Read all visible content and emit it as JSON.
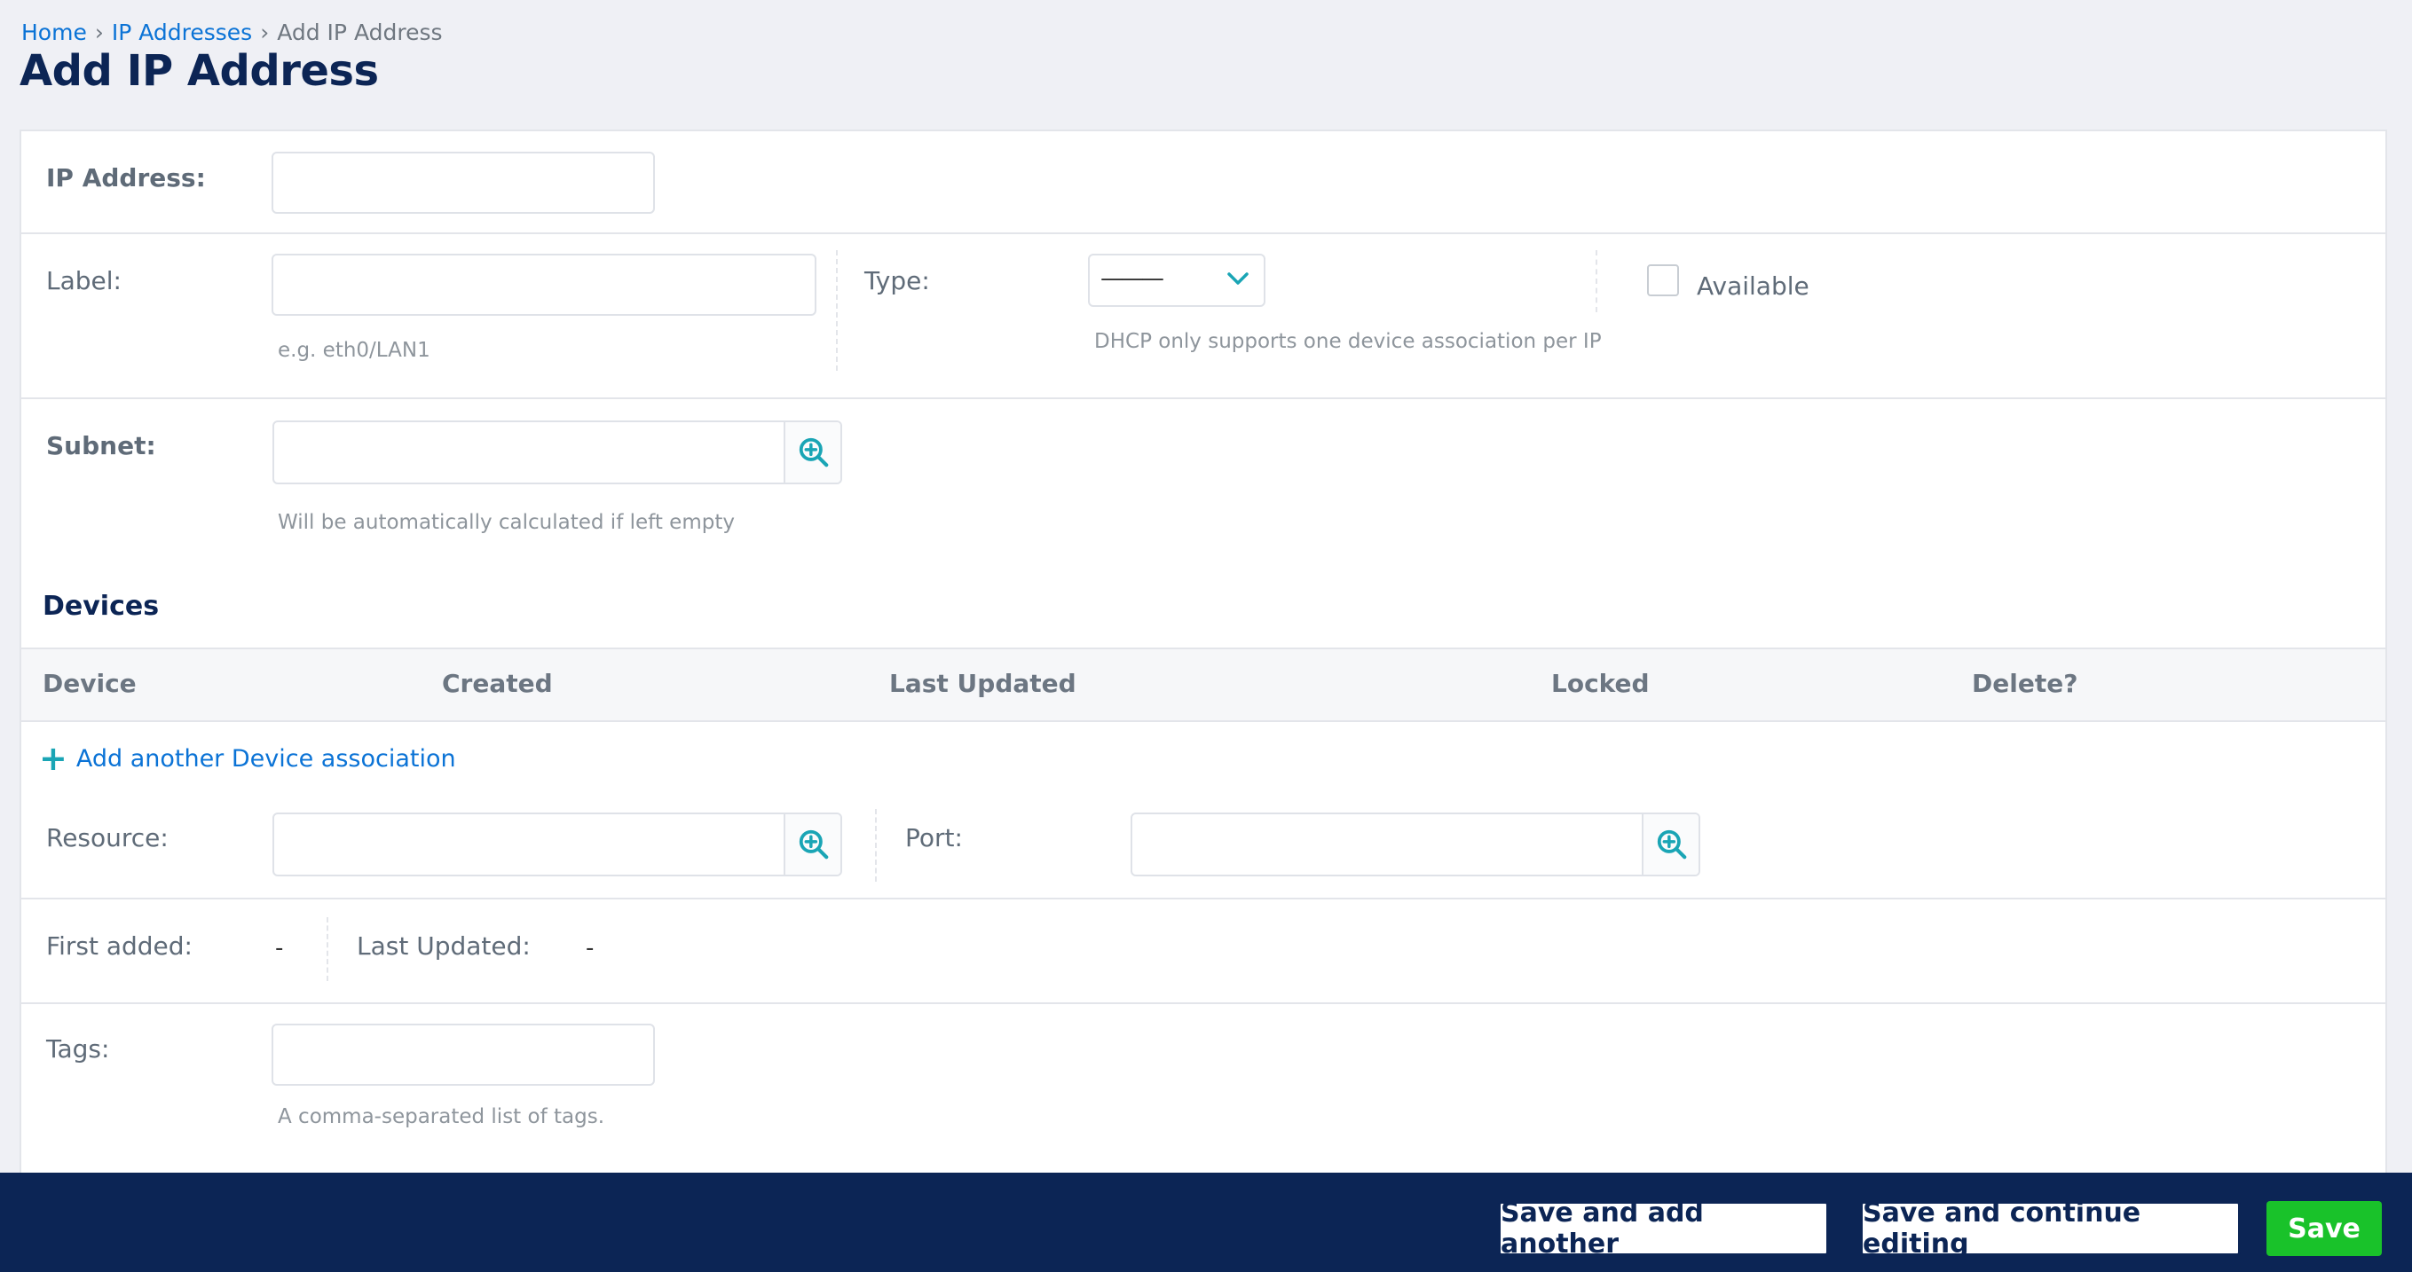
{
  "breadcrumb": {
    "home": "Home",
    "section": "IP Addresses",
    "current": "Add IP Address",
    "separator": "›"
  },
  "page_title": "Add IP Address",
  "form": {
    "ip_address": {
      "label": "IP Address:",
      "value": "",
      "placeholder": ""
    },
    "label": {
      "label": "Label:",
      "value": "",
      "help": "e.g. eth0/LAN1"
    },
    "type": {
      "label": "Type:",
      "selected": "———",
      "help": "DHCP only supports one device association per IP"
    },
    "available": {
      "label": "Available",
      "checked": false
    },
    "subnet": {
      "label": "Subnet:",
      "value": "",
      "help": "Will be automatically calculated if left empty",
      "lookup_icon": "zoom-in-icon"
    }
  },
  "devices": {
    "title": "Devices",
    "columns": [
      "Device",
      "Created",
      "Last Updated",
      "Locked",
      "Delete?"
    ],
    "add_link": "Add another Device association",
    "add_icon": "plus-icon"
  },
  "resource_row": {
    "resource": {
      "label": "Resource:",
      "value": ""
    },
    "port": {
      "label": "Port:",
      "value": ""
    }
  },
  "dates": {
    "first_added": {
      "label": "First added:",
      "value": "-"
    },
    "last_updated": {
      "label": "Last Updated:",
      "value": "-"
    }
  },
  "tags": {
    "label": "Tags:",
    "value": "",
    "help": "A comma-separated list of tags."
  },
  "footer": {
    "save_add_another": "Save and add another",
    "save_continue": "Save and continue editing",
    "save": "Save"
  },
  "colors": {
    "navy": "#0c2555",
    "link": "#0b73d6",
    "teal_icon": "#1aa5b5",
    "save_green": "#19c22a",
    "background": "#eff0f5"
  }
}
